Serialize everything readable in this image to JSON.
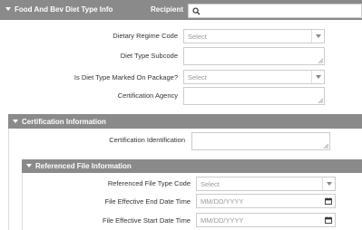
{
  "header": {
    "title": "Food And Bev Diet Type Info",
    "recipient_label": "Recipient"
  },
  "fields": {
    "dietary_regime_code": {
      "label": "Dietary Regime Code",
      "placeholder": "Select"
    },
    "diet_type_subcode": {
      "label": "Diet Type Subcode"
    },
    "is_diet_type_marked": {
      "label": "Is Diet Type Marked On Package?",
      "placeholder": "Select"
    },
    "certification_agency": {
      "label": "Certification Agency"
    }
  },
  "certification_section": {
    "title": "Certification Information",
    "certification_identification": {
      "label": "Certification Identification"
    }
  },
  "referenced_file_section": {
    "title": "Referenced File Information",
    "referenced_file_type_code": {
      "label": "Referenced File Type Code",
      "placeholder": "Select"
    },
    "file_effective_end": {
      "label": "File Effective End Date Time",
      "placeholder": "MM/DD/YYYY"
    },
    "file_effective_start": {
      "label": "File Effective Start Date Time",
      "placeholder": "MM/DD/YYYY"
    }
  },
  "colors": {
    "header_bg": "#8a8a8a",
    "border": "#cccccc"
  }
}
